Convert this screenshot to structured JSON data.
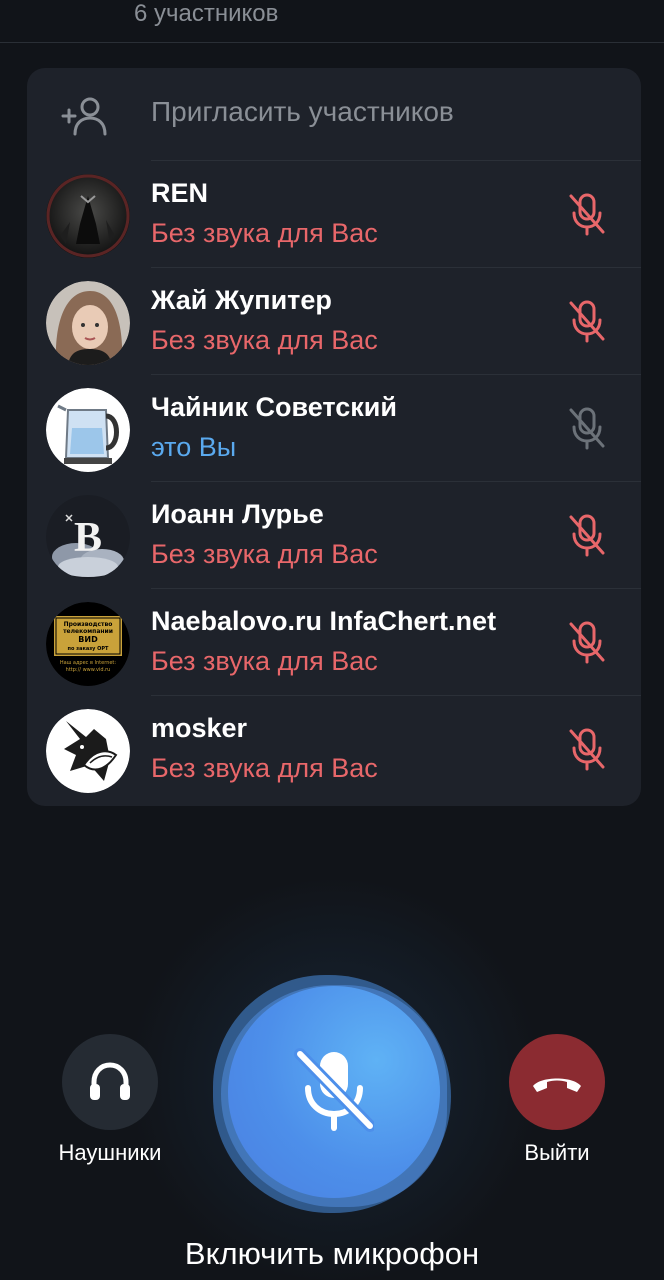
{
  "header": {
    "subtitle": "6 участников"
  },
  "invite": {
    "label": "Пригласить участников"
  },
  "participants": [
    {
      "name": "REN",
      "status": "Без звука для Вас",
      "mic": "mic-muted-red"
    },
    {
      "name": "Жай Жупитер",
      "status": "Без звука для Вас",
      "mic": "mic-muted-red"
    },
    {
      "name": "Чайник Советский",
      "status": "это Вы",
      "mic": "mic-muted-gray"
    },
    {
      "name": "Иоанн Лурье",
      "status": "Без звука для Вас",
      "mic": "mic-muted-red"
    },
    {
      "name": "Naebalovo.ru InfaChert.net",
      "status": "Без звука для Вас",
      "mic": "mic-muted-red"
    },
    {
      "name": "mosker",
      "status": "Без звука для Вас",
      "mic": "mic-muted-red"
    }
  ],
  "avatar_texts": {
    "letter": "B",
    "sign_line1": "Производство",
    "sign_line2": "телекомпании",
    "sign_line3": "ВИD",
    "sign_line4": "по заказу ОРТ",
    "sign_line5": "Наш адрес в Internet:",
    "sign_line6": "http:// www.vid.ru"
  },
  "controls": {
    "headphones_label": "Наушники",
    "leave_label": "Выйти",
    "mic_toggle_label": "Включить микрофон"
  },
  "colors": {
    "background": "#111419",
    "card": "#1e222a",
    "muted_red": "#e8676a",
    "self_blue": "#5aa9ee",
    "mic_button": "#4d8fea",
    "leave_button": "#8b2b31"
  }
}
